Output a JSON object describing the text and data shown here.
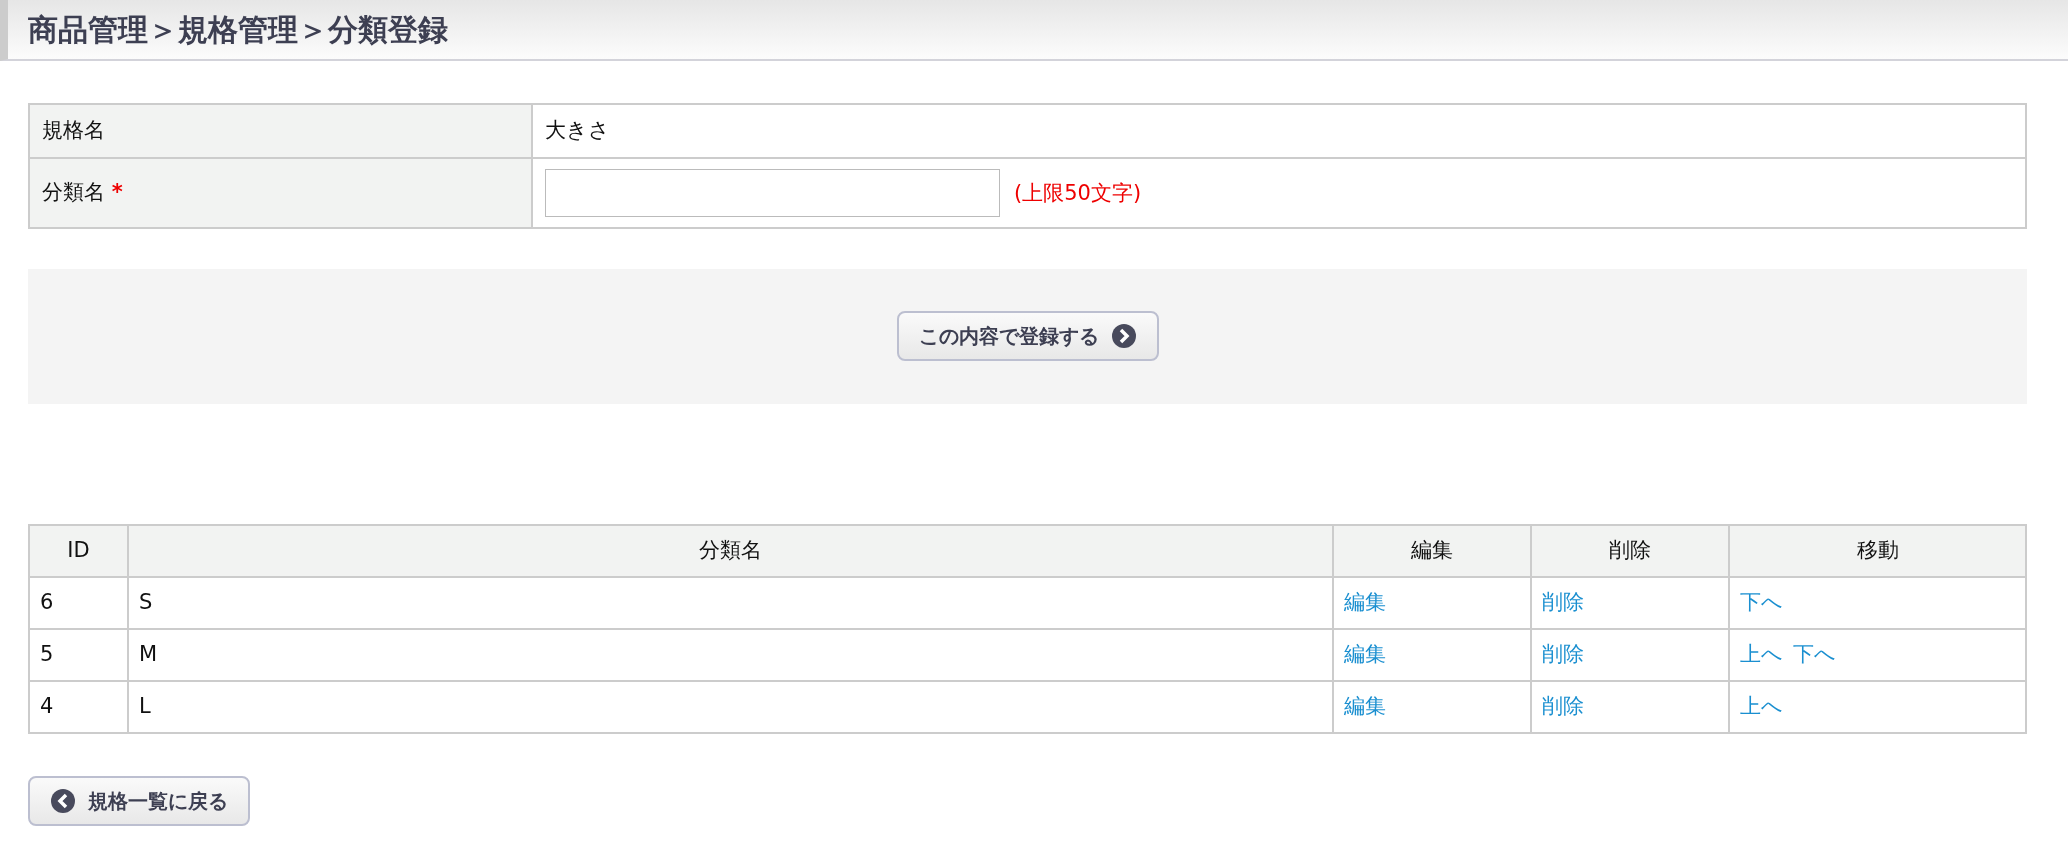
{
  "page_title": "商品管理＞規格管理＞分類登録",
  "form": {
    "rows": [
      {
        "label": "規格名",
        "kind": "text",
        "value": "大きさ"
      },
      {
        "label": "分類名",
        "required_mark": "*",
        "kind": "input",
        "note": "(上限50文字)"
      }
    ]
  },
  "submit_button": {
    "label": "この内容で登録する"
  },
  "table": {
    "columns": [
      "ID",
      "分類名",
      "編集",
      "削除",
      "移動"
    ],
    "rows": [
      {
        "id": "6",
        "name": "S",
        "edit": "編集",
        "delete": "削除",
        "move": [
          "下へ"
        ]
      },
      {
        "id": "5",
        "name": "M",
        "edit": "編集",
        "delete": "削除",
        "move": [
          "上へ",
          "下へ"
        ]
      },
      {
        "id": "4",
        "name": "L",
        "edit": "編集",
        "delete": "削除",
        "move": [
          "上へ"
        ]
      }
    ]
  },
  "back_button": {
    "label": "規格一覧に戻る"
  }
}
